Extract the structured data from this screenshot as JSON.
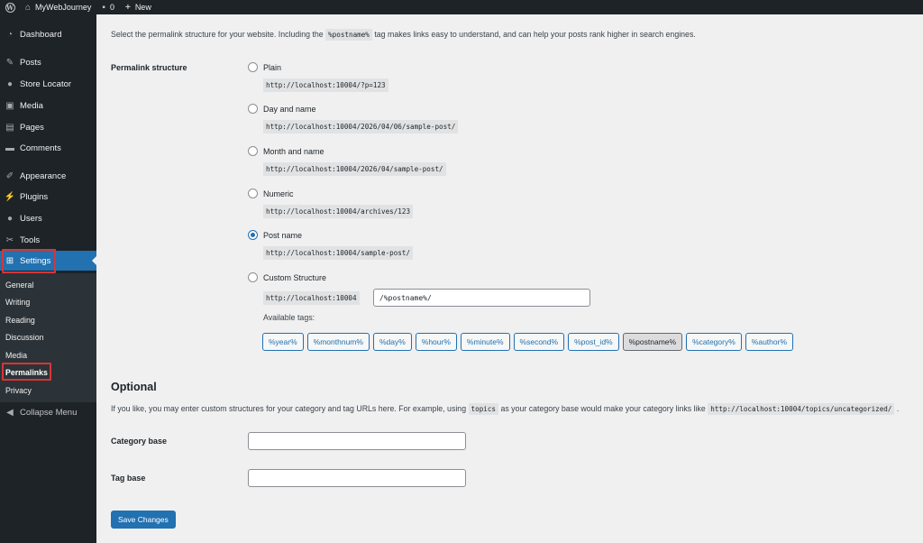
{
  "adminbar": {
    "site_name": "MyWebJourney",
    "comments_count": "0",
    "new_label": "New"
  },
  "sidebar": {
    "items": [
      {
        "label": "Dashboard",
        "icon": "dashboard-icon"
      },
      {
        "label": "Posts",
        "icon": "pin-icon"
      },
      {
        "label": "Store Locator",
        "icon": "location-pin-icon"
      },
      {
        "label": "Media",
        "icon": "media-icon"
      },
      {
        "label": "Pages",
        "icon": "pages-icon"
      },
      {
        "label": "Comments",
        "icon": "comment-icon"
      },
      {
        "label": "Appearance",
        "icon": "brush-icon"
      },
      {
        "label": "Plugins",
        "icon": "plugin-icon"
      },
      {
        "label": "Users",
        "icon": "users-icon"
      },
      {
        "label": "Tools",
        "icon": "wrench-icon"
      },
      {
        "label": "Settings",
        "icon": "settings-icon"
      }
    ],
    "submenu": [
      "General",
      "Writing",
      "Reading",
      "Discussion",
      "Media",
      "Permalinks",
      "Privacy"
    ],
    "collapse_label": "Collapse Menu"
  },
  "main": {
    "intro_before": "Select the permalink structure for your website. Including the",
    "intro_code": "%postname%",
    "intro_after": "tag makes links easy to understand, and can help your posts rank higher in search engines.",
    "permalink_label": "Permalink structure",
    "options": [
      {
        "label": "Plain",
        "example": "http://localhost:10004/?p=123",
        "checked": false
      },
      {
        "label": "Day and name",
        "example": "http://localhost:10004/2026/04/06/sample-post/",
        "checked": false
      },
      {
        "label": "Month and name",
        "example": "http://localhost:10004/2026/04/sample-post/",
        "checked": false
      },
      {
        "label": "Numeric",
        "example": "http://localhost:10004/archives/123",
        "checked": false
      },
      {
        "label": "Post name",
        "example": "http://localhost:10004/sample-post/",
        "checked": true
      },
      {
        "label": "Custom Structure",
        "checked": false
      }
    ],
    "custom_prefix": "http://localhost:10004",
    "custom_value": "/%postname%/",
    "available_tags_label": "Available tags:",
    "tags": [
      "%year%",
      "%monthnum%",
      "%day%",
      "%hour%",
      "%minute%",
      "%second%",
      "%post_id%",
      "%postname%",
      "%category%",
      "%author%"
    ],
    "active_tag": "%postname%",
    "optional_heading": "Optional",
    "optional_before": "If you like, you may enter custom structures for your category and tag URLs here. For example, using",
    "optional_code1": "topics",
    "optional_mid": "as your category base would make your category links like",
    "optional_code2": "http://localhost:10004/topics/uncategorized/",
    "optional_after": ".",
    "category_base_label": "Category base",
    "category_base_value": "",
    "tag_base_label": "Tag base",
    "tag_base_value": "",
    "save_label": "Save Changes"
  },
  "colors": {
    "accent": "#2271b1",
    "admin_bg": "#1d2327",
    "highlight": "#d63638"
  }
}
